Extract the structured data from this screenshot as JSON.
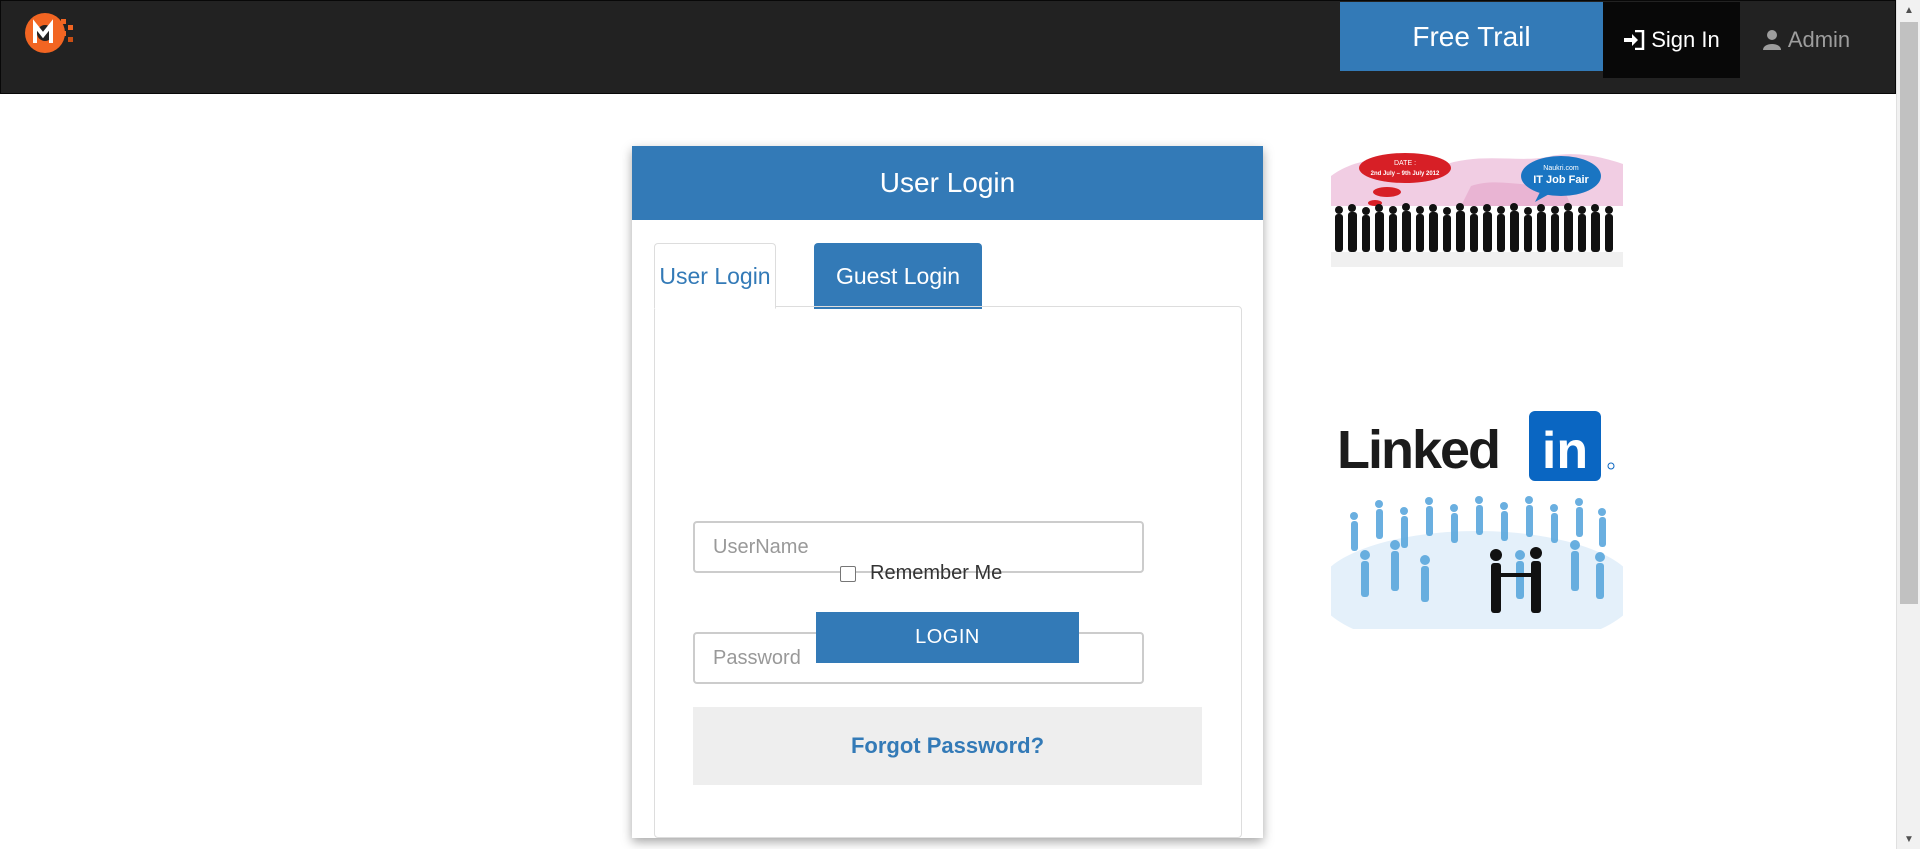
{
  "navbar": {
    "free_trail_label": "Free Trail",
    "sign_in_label": "Sign In",
    "admin_label": "Admin"
  },
  "login_panel": {
    "heading": "User Login",
    "tabs": [
      {
        "label": "User Login",
        "active": true
      },
      {
        "label": "Guest Login",
        "active": false
      }
    ],
    "username_placeholder": "UserName",
    "username_value": "",
    "password_placeholder": "Password",
    "password_value": "",
    "remember_label": "Remember Me",
    "remember_checked": false,
    "login_button_label": "LOGIN",
    "forgot_password_label": "Forgot Password?"
  },
  "ads": {
    "job_fair": {
      "date_label": "DATE :",
      "date_range": "2nd July – 9th July 2012",
      "site": "Naukri.com",
      "event": "IT Job Fair"
    },
    "linkedin": {
      "brand_left": "Linked",
      "brand_right": "in"
    }
  },
  "colors": {
    "navbar_bg": "#222222",
    "primary": "#337ab7",
    "sign_in_bg": "#080808",
    "logo_orange": "#f26522"
  }
}
